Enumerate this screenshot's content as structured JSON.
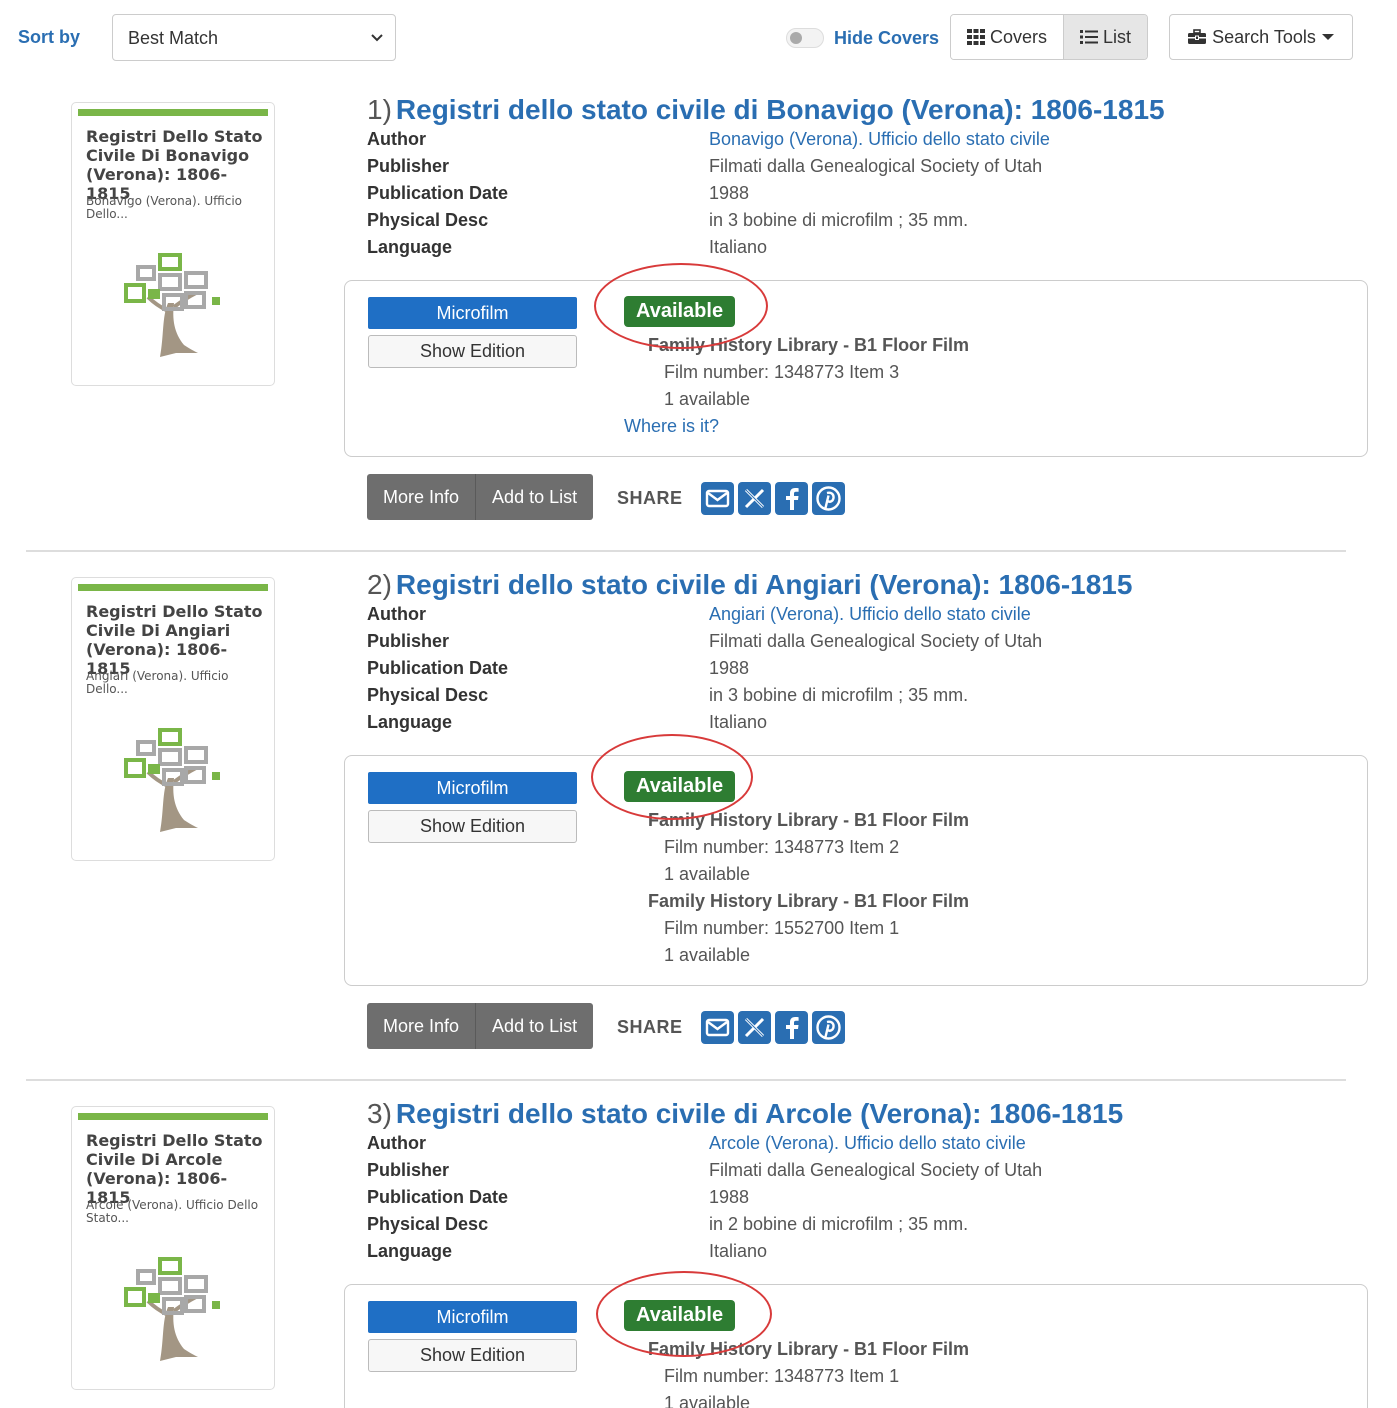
{
  "toolbar": {
    "sort_label": "Sort by",
    "sort_value": "Best Match",
    "hide_covers_label": "Hide Covers",
    "covers_label": "Covers",
    "list_label": "List",
    "search_tools_label": "Search Tools"
  },
  "results": [
    {
      "number": "1)",
      "title": "Registri dello stato civile di Bonavigo (Verona): 1806-1815",
      "cover": {
        "title": "Registri Dello Stato Civile Di Bonavigo (Verona): 1806-1815",
        "author": "Bonavigo (Verona). Ufficio Dello..."
      },
      "meta": [
        {
          "label": "Author",
          "value": "Bonavigo (Verona). Ufficio dello stato civile"
        },
        {
          "label": "Publisher",
          "value": "Filmati dalla Genealogical Society of Utah"
        },
        {
          "label": "Publication Date",
          "value": "1988"
        },
        {
          "label": "Physical Desc",
          "value": "in 3 bobine di microfilm ; 35 mm."
        },
        {
          "label": "Language",
          "value": "Italiano"
        }
      ],
      "format": "Microfilm",
      "show_edition": "Show Edition",
      "status": "Available",
      "holdings": [
        {
          "location": "Family History Library - B1 Floor Film",
          "film": "Film number: 1348773 Item 3",
          "available": "1 available"
        }
      ],
      "where_is_it": "Where is it?"
    },
    {
      "number": "2)",
      "title": "Registri dello stato civile di Angiari (Verona): 1806-1815",
      "cover": {
        "title": "Registri Dello Stato Civile Di Angiari (Verona): 1806-1815",
        "author": "Angiari (Verona). Ufficio Dello..."
      },
      "meta": [
        {
          "label": "Author",
          "value": "Angiari (Verona). Ufficio dello stato civile"
        },
        {
          "label": "Publisher",
          "value": "Filmati dalla Genealogical Society of Utah"
        },
        {
          "label": "Publication Date",
          "value": "1988"
        },
        {
          "label": "Physical Desc",
          "value": "in 3 bobine di microfilm ; 35 mm."
        },
        {
          "label": "Language",
          "value": "Italiano"
        }
      ],
      "format": "Microfilm",
      "show_edition": "Show Edition",
      "status": "Available",
      "holdings": [
        {
          "location": "Family History Library - B1 Floor Film",
          "film": "Film number: 1348773 Item 2",
          "available": "1 available"
        },
        {
          "location": "Family History Library - B1 Floor Film",
          "film": "Film number: 1552700 Item 1",
          "available": "1 available"
        }
      ]
    },
    {
      "number": "3)",
      "title": "Registri dello stato civile di Arcole (Verona): 1806-1815",
      "cover": {
        "title": "Registri Dello Stato Civile Di Arcole (Verona): 1806-1815",
        "author": "Arcole (Verona). Ufficio Dello Stato..."
      },
      "meta": [
        {
          "label": "Author",
          "value": "Arcole (Verona). Ufficio dello stato civile"
        },
        {
          "label": "Publisher",
          "value": "Filmati dalla Genealogical Society of Utah"
        },
        {
          "label": "Publication Date",
          "value": "1988"
        },
        {
          "label": "Physical Desc",
          "value": "in 2 bobine di microfilm ; 35 mm."
        },
        {
          "label": "Language",
          "value": "Italiano"
        }
      ],
      "format": "Microfilm",
      "show_edition": "Show Edition",
      "status": "Available",
      "holdings": [
        {
          "location": "Family History Library - B1 Floor Film",
          "film": "Film number: 1348773 Item 1",
          "available": "1 available"
        }
      ]
    }
  ],
  "actions": {
    "more_info": "More Info",
    "add_to_list": "Add to List",
    "share": "SHARE"
  },
  "icons": [
    "chevron-down-icon",
    "grid-icon",
    "list-icon",
    "toolbox-icon",
    "email-icon",
    "x-icon",
    "facebook-icon",
    "pinterest-icon",
    "tree-logo-icon"
  ],
  "colors": {
    "link": "#2a6eb2",
    "available": "#2e7d32",
    "format_button": "#1f6fc5",
    "annotation_circle": "#d83a3a"
  }
}
